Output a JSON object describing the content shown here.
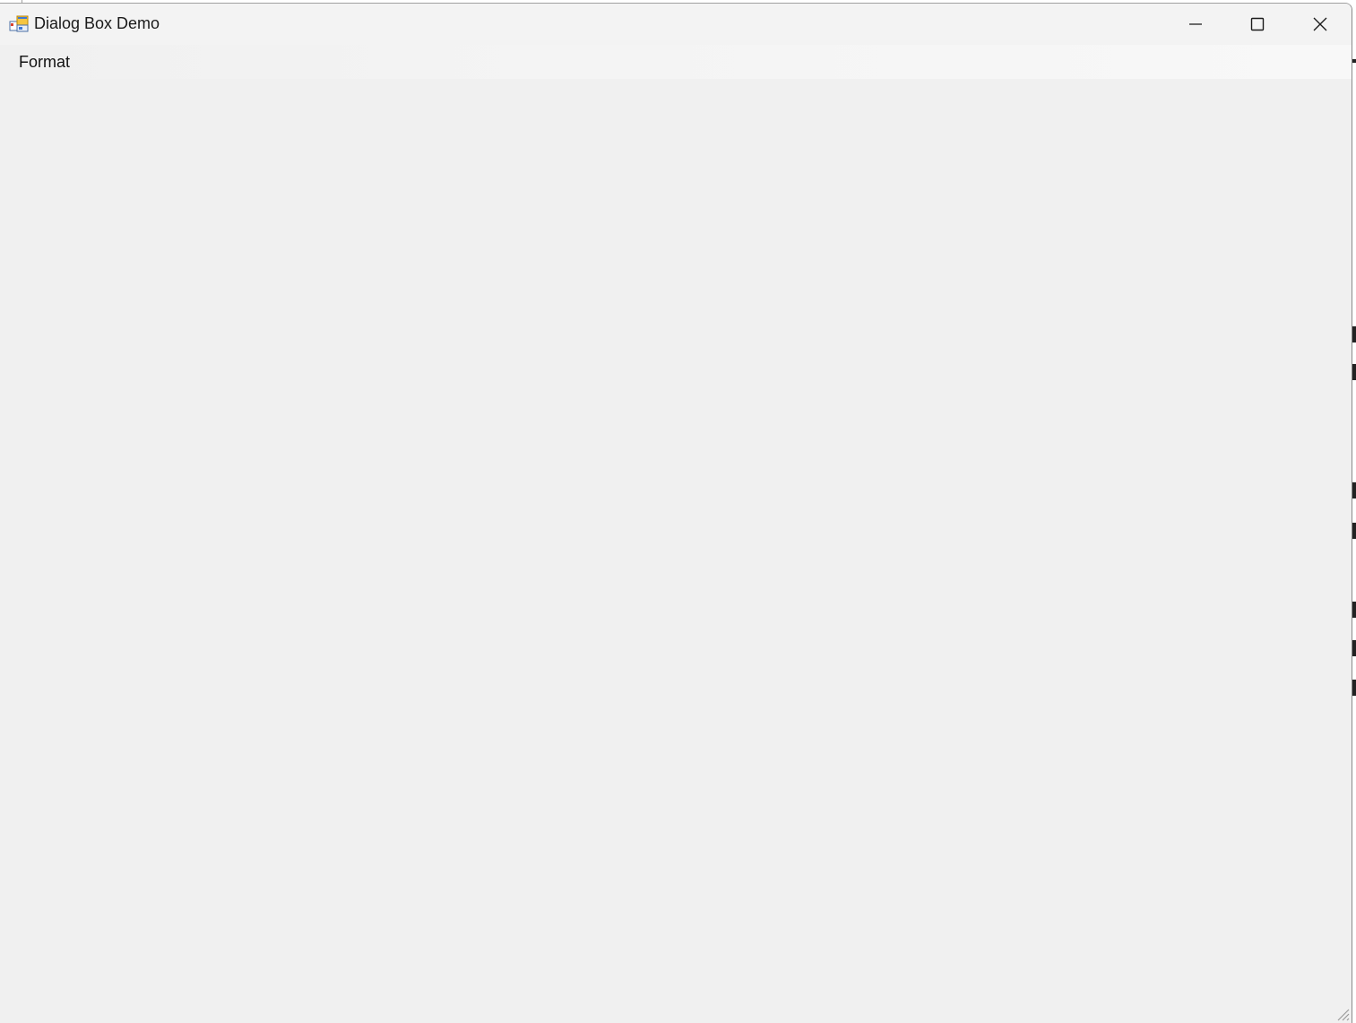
{
  "window": {
    "title": "Dialog Box Demo",
    "app_icon": "form-app-icon",
    "controls": {
      "minimize_icon": "minimize-icon",
      "maximize_icon": "maximize-icon",
      "close_icon": "close-icon"
    }
  },
  "menubar": {
    "items": [
      {
        "label": "Format"
      }
    ]
  },
  "colors": {
    "client_background": "#f0f0f0",
    "titlebar_background": "#f3f3f3",
    "text": "#1a1a1a"
  }
}
